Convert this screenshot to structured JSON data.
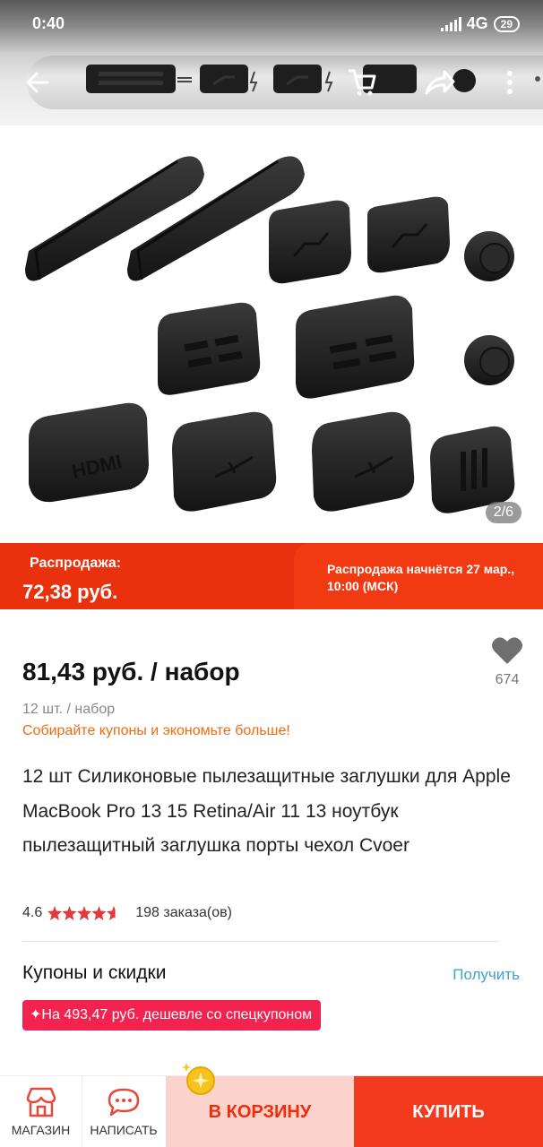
{
  "status_bar": {
    "time": "0:40",
    "network": "4G",
    "battery": "29"
  },
  "gallery": {
    "counter": "2/6",
    "plug_labels": [
      "HDMI"
    ]
  },
  "sale_banner": {
    "label": "Распродажа:",
    "price": "72,38 руб.",
    "start_notice": "Распродажа начнётся 27 мар., 10:00 (МСК)"
  },
  "product": {
    "price": "81,43 руб. / набор",
    "unit_info": "12 шт. / набор",
    "coupon_promo": "Собирайте купоны и экономьте больше!",
    "wishlist_count": "674",
    "title": "12 шт Силиконовые пылезащитные заглушки для Apple MacBook Pro 13 15 Retina/Air 11 13 ноутбук пылезащитный заглушка порты чехол Cvoer",
    "rating": "4.6",
    "rating_stars": 4.6,
    "orders": "198 заказа(ов)"
  },
  "coupons": {
    "title": "Купоны и скидки",
    "get_label": "Получить",
    "special_coupon": "✦На 493,47 руб. дешевле со спецкупоном"
  },
  "bottom_bar": {
    "store_label": "МАГАЗИН",
    "message_label": "НАПИСАТЬ",
    "cart_label": "В КОРЗИНУ",
    "buy_label": "КУПИТЬ"
  },
  "colors": {
    "sale_red": "#e9310d",
    "coupon_pink": "#f3224f",
    "promo_orange": "#f06a10",
    "link_blue": "#3aa6c1",
    "cart_bg": "#fcd3cc",
    "buy_bg": "#f33a1e"
  },
  "icons": {
    "back": "arrow-left-icon",
    "cart": "cart-icon",
    "share": "share-icon",
    "more": "more-vertical-icon",
    "wishlist": "heart-icon",
    "store": "store-icon",
    "message": "chat-icon",
    "coin": "coin-icon"
  }
}
